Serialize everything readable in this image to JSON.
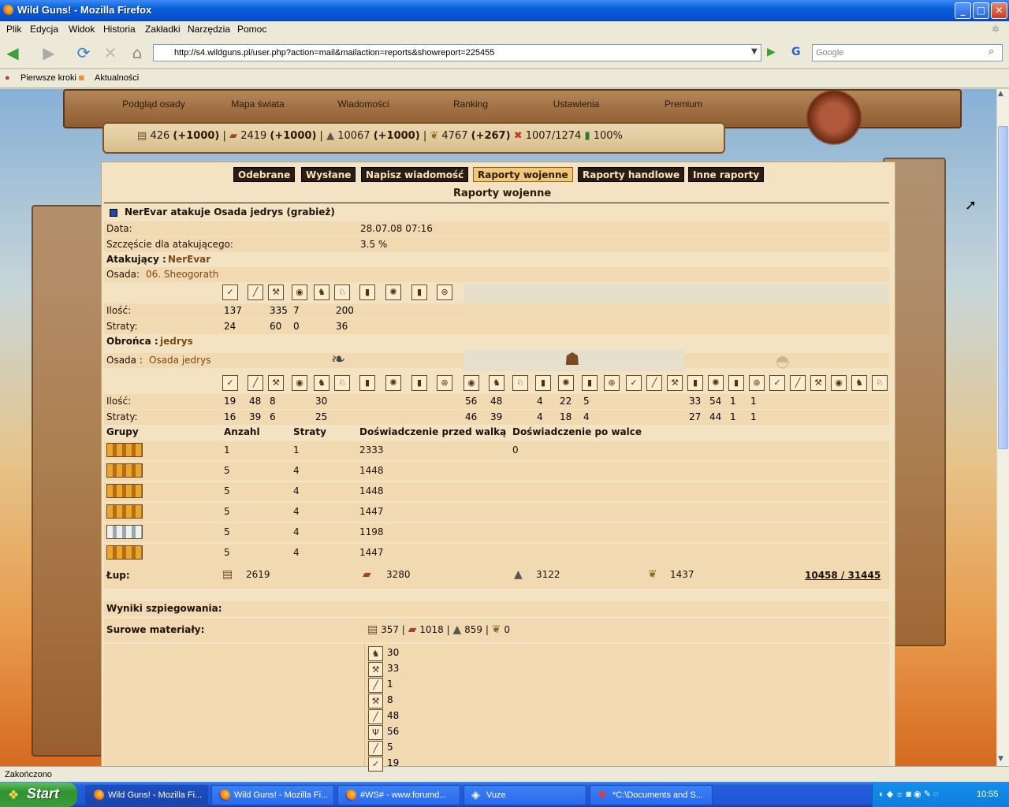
{
  "window": {
    "title": "Wild Guns! - Mozilla Firefox",
    "min": "_",
    "max": "□",
    "close": "✕"
  },
  "menu": [
    "Plik",
    "Edycja",
    "Widok",
    "Historia",
    "Zakładki",
    "Narzędzia",
    "Pomoc"
  ],
  "nav": {
    "url": "http://s4.wildguns.pl/user.php?action=mail&mailaction=reports&showreport=225455",
    "search_placeholder": "Google"
  },
  "bookmarks": [
    "Pierwsze kroki",
    "Aktualności"
  ],
  "game_nav": [
    "Podgląd osady",
    "Mapa świata",
    "Wiadomości",
    "Ranking",
    "Ustawienia",
    "Premium"
  ],
  "resources": {
    "r1": "426",
    "r1_inc": "(+1000)",
    "sep": "|",
    "r2": "2419",
    "r2_inc": "(+1000)",
    "r3": "10067",
    "r3_inc": "(+1000)",
    "r4": "4767",
    "r4_inc": "(+267)",
    "pop": "1007/1274",
    "morale": "100%"
  },
  "tabs": [
    "Odebrane",
    "Wysłane",
    "Napisz wiadomość",
    "Raporty wojenne",
    "Raporty handlowe",
    "Inne raporty"
  ],
  "section_title": "Raporty wojenne",
  "report": {
    "title": "NerEvar atakuje Osada jedrys (grabież)",
    "date_label": "Data:",
    "date": "28.07.08 07:16",
    "luck_label": "Szczęście dla atakującego:",
    "luck": "3.5 %",
    "attacker_label": "Atakujący :",
    "attacker": "NerEvar",
    "att_village_label": "Osada:",
    "att_village": "06. Sheogorath",
    "qty_label": "Ilość:",
    "loss_label": "Straty:",
    "att_qty": [
      "137",
      "",
      "335",
      "7",
      "",
      "200",
      "",
      "",
      "",
      ""
    ],
    "att_loss": [
      "24",
      "",
      "60",
      "0",
      "",
      "36",
      "",
      "",
      "",
      ""
    ],
    "defender_label": "Obrońca :",
    "defender": "jedrys",
    "def_village_label": "Osada :",
    "def_village": "Osada jedrys",
    "d1_qty": [
      "19",
      "48",
      "8",
      "",
      "30",
      "",
      "",
      "",
      "",
      ""
    ],
    "d1_loss": [
      "16",
      "39",
      "6",
      "",
      "25",
      "",
      "",
      "",
      "",
      ""
    ],
    "d2_qty": [
      "56",
      "48",
      "",
      "4",
      "22",
      "5",
      "",
      "",
      "",
      ""
    ],
    "d2_loss": [
      "46",
      "39",
      "",
      "4",
      "18",
      "4",
      "",
      "",
      "",
      ""
    ],
    "d3_qty": [
      "33",
      "54",
      "1",
      "1",
      "",
      "",
      "",
      "",
      "",
      ""
    ],
    "d3_loss": [
      "27",
      "44",
      "1",
      "1",
      "",
      "",
      "",
      "",
      "",
      ""
    ],
    "groups_header": [
      "Grupy",
      "Anzahl",
      "Straty",
      "Doświadczenie przed walką",
      "Doświadczenie po walce"
    ],
    "groups": [
      {
        "anzahl": "1",
        "straty": "1",
        "before": "2333",
        "after": "0"
      },
      {
        "anzahl": "5",
        "straty": "4",
        "before": "1448",
        "after": ""
      },
      {
        "anzahl": "5",
        "straty": "4",
        "before": "1448",
        "after": ""
      },
      {
        "anzahl": "5",
        "straty": "4",
        "before": "1447",
        "after": ""
      },
      {
        "anzahl": "5",
        "straty": "4",
        "before": "1198",
        "after": ""
      },
      {
        "anzahl": "5",
        "straty": "4",
        "before": "1447",
        "after": ""
      }
    ],
    "loot_label": "Łup:",
    "loot": [
      "2619",
      "3280",
      "3122",
      "1437"
    ],
    "loot_total": "10458 / 31445",
    "spy_label": "Wyniki szpiegowania:",
    "raw_label": "Surowe materiały:",
    "raw": [
      "357",
      "1018",
      "859",
      "0"
    ],
    "raw_sep": "|",
    "spy_units": [
      "30",
      "33",
      "1",
      "8",
      "48",
      "56",
      "5",
      "19"
    ]
  },
  "status": "Zakończono",
  "taskbar": {
    "start": "Start",
    "tasks": [
      "Wild Guns! - Mozilla Fi...",
      "Wild Guns! - Mozilla Fi...",
      "#WS# - www.forumd...",
      "Vuze",
      "*C:\\Documents and S..."
    ],
    "clock": "10:55"
  }
}
